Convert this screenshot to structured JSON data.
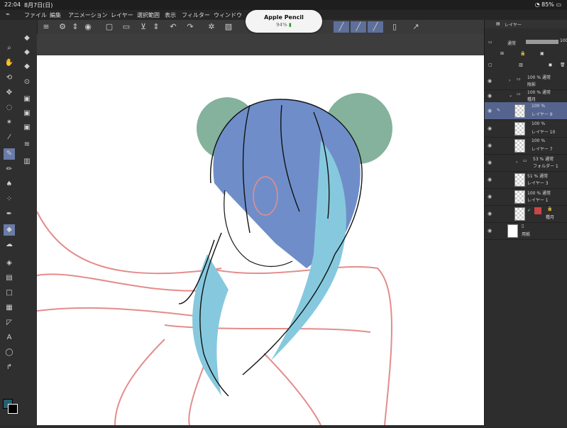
{
  "status": {
    "time": "22:04",
    "date": "8月7日(日)",
    "battery": "85%"
  },
  "menu": {
    "items": [
      "ファイル",
      "編集",
      "アニメーション",
      "レイヤー",
      "選択範囲",
      "表示",
      "フィルター",
      "ウィンドウ"
    ]
  },
  "toast": {
    "title": "Apple Pencil",
    "percent": "94%"
  },
  "layers_panel": {
    "tab_label": "レイヤー",
    "blend_mode": "通常",
    "opacity": "100",
    "rows": [
      {
        "percent": "100 % 通常",
        "name": "陰影"
      },
      {
        "percent": "100 % 通常",
        "name": "種月"
      },
      {
        "percent": "100 %",
        "name": "レイヤー 9"
      },
      {
        "percent": "100 %",
        "name": "レイヤー 10"
      },
      {
        "percent": "100 %",
        "name": "レイヤー 7"
      },
      {
        "percent": "53 % 通常",
        "name": "フォルダー 1"
      },
      {
        "percent": "51 % 通常",
        "name": "レイヤー 3"
      },
      {
        "percent": "100 % 通常",
        "name": "レイヤー 1"
      },
      {
        "percent": "",
        "name": "種月"
      },
      {
        "percent": "",
        "name": "用紙"
      }
    ]
  },
  "colors": {
    "hair_blue": "#6f8ec9",
    "hair_cyan": "#86c9de",
    "ear_green": "#6ea58b",
    "sketch_red": "#e48c8c",
    "fg_color": "#255f72"
  },
  "icons": {
    "toolbar": [
      "menu-icon",
      "settings-icon",
      "view-icon",
      "new-icon",
      "open-icon",
      "save-icon",
      "undo-icon",
      "redo-icon",
      "transform-icon",
      "select-icon",
      "deselect-icon",
      "brush-icon",
      "pen-icon",
      "pencil-icon",
      "ruler-icon",
      "page-icon",
      "share-icon"
    ],
    "tools": [
      "zoom-icon",
      "hand-icon",
      "rotate-icon",
      "move-icon",
      "lasso-icon",
      "magic-wand-icon",
      "eyedropper-icon",
      "pen-tool-icon",
      "pencil-tool-icon",
      "brush-tool-icon",
      "airbrush-icon",
      "decoration-icon",
      "eraser-icon",
      "blend-icon",
      "fill-icon",
      "gradient-icon",
      "shape-icon",
      "frame-icon",
      "ruler-tool-icon",
      "text-icon",
      "balloon-icon",
      "correct-line-icon"
    ]
  }
}
